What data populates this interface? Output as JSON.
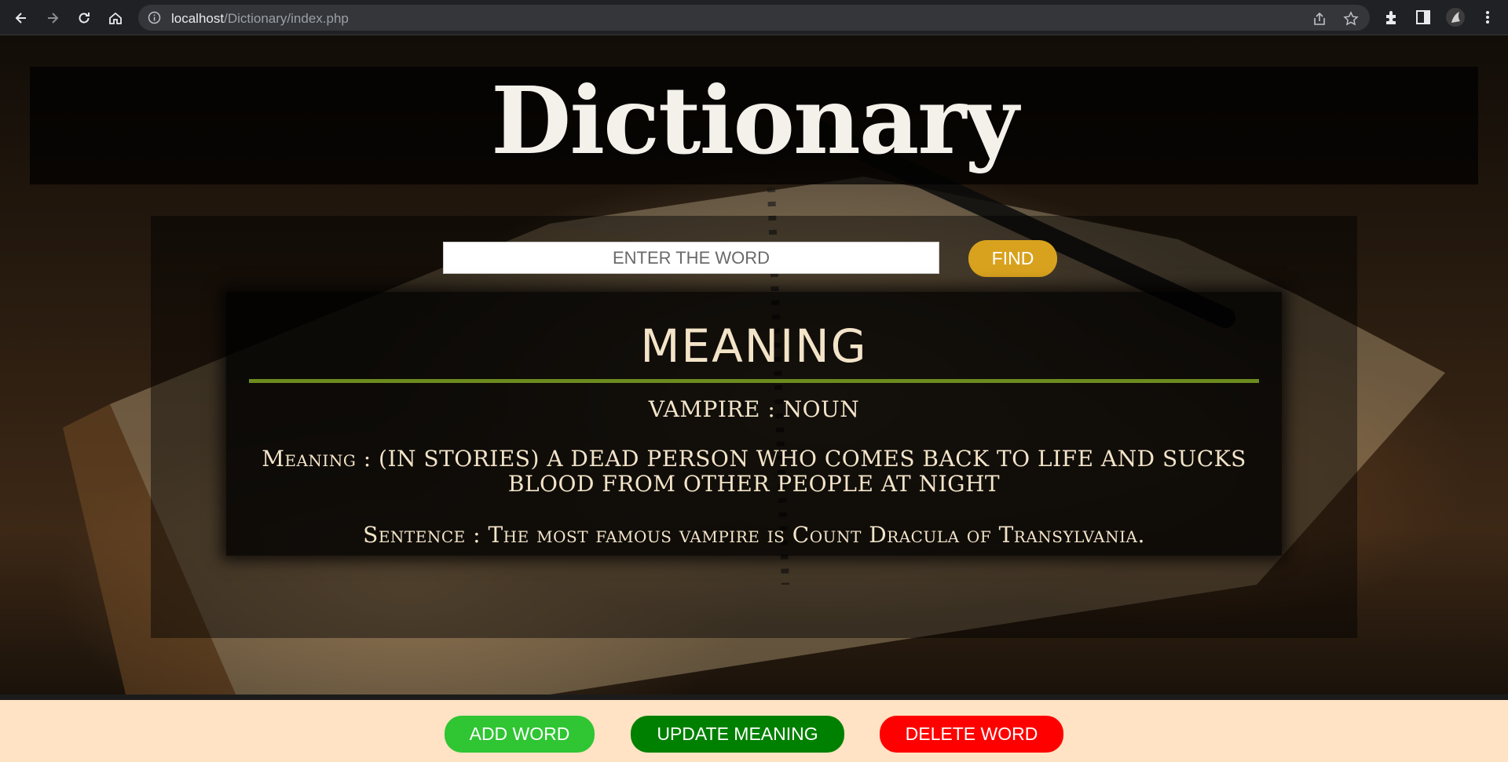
{
  "browser": {
    "url_host": "localhost",
    "url_path": "/Dictionary/index.php"
  },
  "header": {
    "title": "Dictionary"
  },
  "search": {
    "placeholder": "ENTER THE WORD",
    "find_label": "FIND"
  },
  "result": {
    "heading": "MEANING",
    "word_line": "VAMPIRE : NOUN",
    "meaning_line": "Meaning : (IN STORIES) A DEAD PERSON WHO COMES BACK TO LIFE AND SUCKS BLOOD FROM OTHER PEOPLE AT NIGHT",
    "sentence_line": "Sentence : The most famous vampire is Count Dracula of Transylvania."
  },
  "footer": {
    "add_label": "ADD WORD",
    "update_label": "UPDATE MEANING",
    "delete_label": "DELETE WORD"
  },
  "colors": {
    "find_button": "#d9a21e",
    "add_button": "#2fc533",
    "update_button": "#008000",
    "delete_button": "#ff0000",
    "rule": "#6c8b1f",
    "footer_bg": "#ffe3c4"
  },
  "icons": [
    "back-icon",
    "forward-icon",
    "reload-icon",
    "home-icon",
    "info-icon",
    "share-icon",
    "star-icon",
    "extensions-icon",
    "sidepanel-icon",
    "profile-avatar",
    "menu-icon"
  ]
}
